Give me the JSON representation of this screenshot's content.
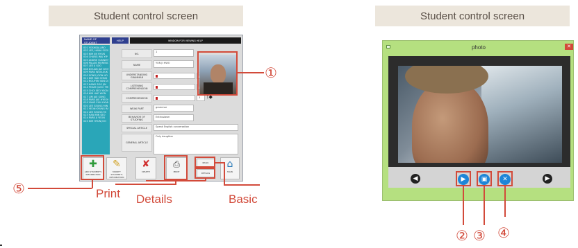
{
  "left_panel": {
    "header": "Student control screen",
    "app": {
      "col_header_name": "NAME OF STUDENT",
      "menu_help": "HELP",
      "window_title": "WINDOW FOR VIEWING HELP",
      "students": [
        "001 YOSHIDA JIRO",
        "002 LEE, HANA SOOK",
        "003 KIM JIN HYUN",
        "004 CHANG WAI YIP",
        "005 ANDRE SUNNIER MATHIEU",
        "006 PALAIS MORENO",
        "007 LEE JI SOO",
        "008 DOUAB JAE WON",
        "009 PARK WON-SUK",
        "010 SONG JOON HO",
        "011 KIM HAN SONG",
        "012 NGUYEN VAN DUONG",
        "013 HANG SOO JIN",
        "014 PHAM QUOC TRUNG",
        "015 CHOI SEO YEON",
        "016 KIM HAE WON",
        "017 LIM JAE SUNG",
        "018 PARK JAE HYEON",
        "019 YANG EUN HYANG",
        "020 LEE SEUNG MIN",
        "021 YEON KYUNG RAE",
        "022 LEE SEUNG MI",
        "023 HAN MIN SEO",
        "024 PARK JI YEON",
        "025 KIM HYUN JOO"
      ],
      "fields": {
        "no_label": "NO.",
        "no_value": "1",
        "name_label": "NAME",
        "name_value": "YUN JI HWO",
        "grammar_label": "UNDERSTANDING GRAMMAR",
        "grammar_value": "3",
        "listening_label": "LISTENING COMPREHENSION",
        "listening_value": "3",
        "comprehension_label": "COMPREHENSION",
        "comprehension_value": "3",
        "weak_label": "WEAK PART",
        "weak_value": "grammar",
        "behavior_label": "BEHAVIOR OF STUDYING",
        "behavior_value": "Enthusiasm",
        "special_label": "SPECIAL ARTICLE",
        "special_value": "Speak English conversation",
        "general_label": "GENERAL ARTICLE",
        "general_value": "Only daughter"
      },
      "toolbar": {
        "add": "ADD STUDENT'S INFORMATION",
        "modify": "MODIFY STUDENT'S INFORMATION",
        "delete": "DELETE",
        "print": "PRINT",
        "basic": "BASIC",
        "details": "DETAILS",
        "main": "MAIN"
      }
    },
    "callouts": {
      "one": "①",
      "five": "⑤",
      "print": "Print",
      "details": "Details",
      "basic": "Basic"
    }
  },
  "right_panel": {
    "header": "Student control screen",
    "window_title": "photo",
    "callouts": {
      "two": "②",
      "three": "③",
      "four": "④"
    }
  },
  "colors": {
    "accent": "#d24a3a",
    "header_bg": "#ece6dc",
    "list_bg": "#2aa6b8",
    "photo_frame": "#b5e080"
  }
}
